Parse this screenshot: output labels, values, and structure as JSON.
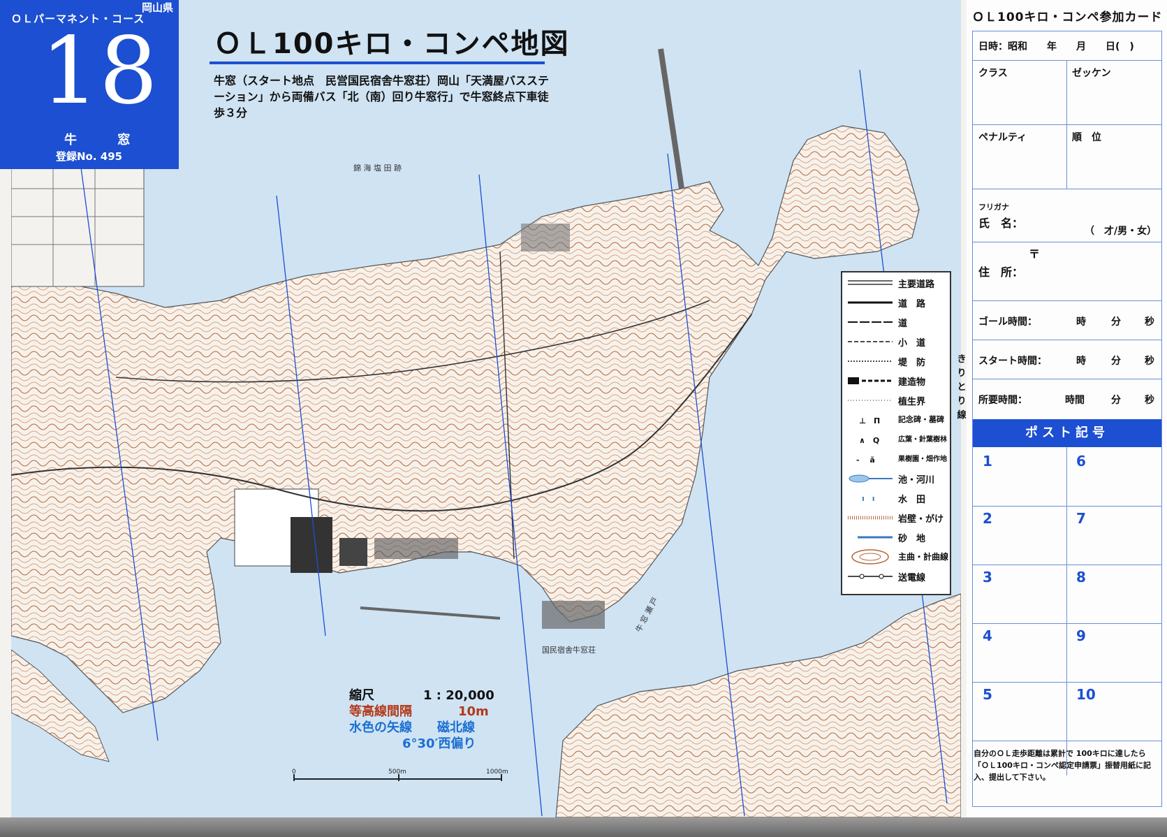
{
  "header": {
    "prefecture": "岡山県",
    "course_type": "ＯＬパーマネント・コース",
    "course_number": "18",
    "place_name": "牛 窓",
    "registration": "登録No. 495"
  },
  "map": {
    "title": "ＯＬ100キロ・コンペ地図",
    "access_text": "牛窓（スタート地点　民営国民宿舎牛窓荘）岡山「天満屋バスステーション」から両備バス「北（南）回り牛窓行」で牛窓終点下車徒歩３分",
    "labels": {
      "place_top": "錦 海 塩 田 跡",
      "lodge": "国民宿舎牛窓荘",
      "strait": "牛 窓 瀬 戸"
    },
    "scale": {
      "scale_label": "縮尺",
      "scale_value": "1 : 20,000",
      "contour_label": "等高線間隔",
      "contour_value": "10m",
      "arrow_label": "水色の矢線",
      "north_label": "磁北線",
      "declination": "6°30′西偏り",
      "bar_0": "0",
      "bar_500": "500m",
      "bar_1000": "1000m"
    },
    "colors": {
      "water": "#cfe3f3",
      "land": "#f7f1ea",
      "contour": "#b5673a",
      "accent": "#1c4fd1"
    }
  },
  "legend": {
    "items": [
      {
        "label": "主要道路",
        "icon": "double-line"
      },
      {
        "label": "道　路",
        "icon": "thick-line"
      },
      {
        "label": "道",
        "icon": "medium-line"
      },
      {
        "label": "小　道",
        "icon": "dashed-line"
      },
      {
        "label": "堤　防",
        "icon": "dike-line"
      },
      {
        "label": "建造物",
        "icon": "building-symbol"
      },
      {
        "label": "植生界",
        "icon": "dotted-line"
      },
      {
        "label": "記念碑・墓碑",
        "icon": "monument-symbol"
      },
      {
        "label": "広葉・針葉樹林",
        "icon": "forest-symbol"
      },
      {
        "label": "果樹園・畑作地",
        "icon": "orchard-symbol"
      },
      {
        "label": "池・河川",
        "icon": "water-symbol"
      },
      {
        "label": "水　田",
        "icon": "paddy-symbol"
      },
      {
        "label": "岩壁・がけ",
        "icon": "cliff-symbol"
      },
      {
        "label": "砂　地",
        "icon": "sand-symbol"
      },
      {
        "label": "主曲・計曲線",
        "icon": "contour-symbol"
      },
      {
        "label": "送電線",
        "icon": "powerline-symbol"
      }
    ]
  },
  "card": {
    "title": "ＯＬ100キロ・コンペ参加カード",
    "date_label": "日時：昭和　　年　　月　　日(　)",
    "class_label": "クラス",
    "bib_label": "ゼッケン",
    "penalty_label": "ペナルティ",
    "rank_label": "順　位",
    "furigana_label": "フリガナ",
    "name_label": "氏　名：",
    "age_sex_label": "（　才/男・女）",
    "postal_mark": "〒",
    "address_label": "住　所：",
    "goal_label": "ゴール時間：",
    "start_label": "スタート時間：",
    "elapsed_label": "所要時間：",
    "hour": "時",
    "minute": "分",
    "second": "秒",
    "hours": "時間",
    "post_header": "ポスト記号",
    "posts": [
      "1",
      "2",
      "3",
      "4",
      "5",
      "6",
      "7",
      "8",
      "9",
      "10"
    ],
    "note": "自分のＯＬ走歩距離は累計で 100キロに達したら「ＯＬ100キロ・コンペ認定申請票」振替用紙に記入、提出して下さい。",
    "cut_label": "きりとり線"
  }
}
